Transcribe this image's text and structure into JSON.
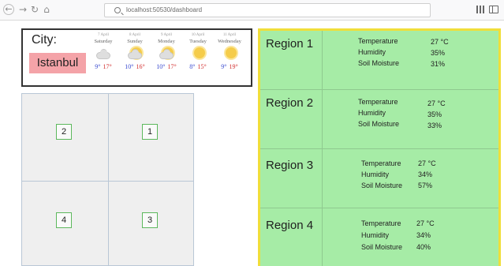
{
  "browser": {
    "url": "localhost:50530/dashboard",
    "icons": [
      "back-icon",
      "forward-icon",
      "reload-icon",
      "home-icon",
      "search-icon",
      "library-icon",
      "sidebar-icon"
    ]
  },
  "weather": {
    "city_label": "City:",
    "city": "Istanbul",
    "forecast": [
      {
        "date": "7 April",
        "day": "Saturday",
        "condition": "cloudy",
        "low": "9°",
        "high": "17°"
      },
      {
        "date": "8 April",
        "day": "Sunday",
        "condition": "partly-cloudy",
        "low": "10°",
        "high": "16°"
      },
      {
        "date": "9 April",
        "day": "Monday",
        "condition": "partly-cloudy",
        "low": "10°",
        "high": "17°"
      },
      {
        "date": "10 April",
        "day": "Tuesday",
        "condition": "sunny",
        "low": "8°",
        "high": "15°"
      },
      {
        "date": "11 April",
        "day": "Wednesday",
        "condition": "sunny",
        "low": "9°",
        "high": "19°"
      }
    ]
  },
  "zones": [
    {
      "label": "2"
    },
    {
      "label": "1"
    },
    {
      "label": "4"
    },
    {
      "label": "3"
    }
  ],
  "metric_labels": {
    "temperature": "Temperature",
    "humidity": "Humidity",
    "soil": "Soil Moisture"
  },
  "regions": [
    {
      "name": "Region 1",
      "temperature": "27 °C",
      "humidity": "35%",
      "soil": "31%"
    },
    {
      "name": "Region 2",
      "temperature": "27 °C",
      "humidity": "35%",
      "soil": "33%"
    },
    {
      "name": "Region 3",
      "temperature": "27 °C",
      "humidity": "34%",
      "soil": "57%"
    },
    {
      "name": "Region 4",
      "temperature": "27 °C",
      "humidity": "34%",
      "soil": "40%"
    }
  ],
  "colors": {
    "city_highlight": "#f4a3a8",
    "region_background": "#a6eca6",
    "region_border": "#f0de3a",
    "temp_low": "#3a4bd0",
    "temp_high": "#d23030"
  }
}
